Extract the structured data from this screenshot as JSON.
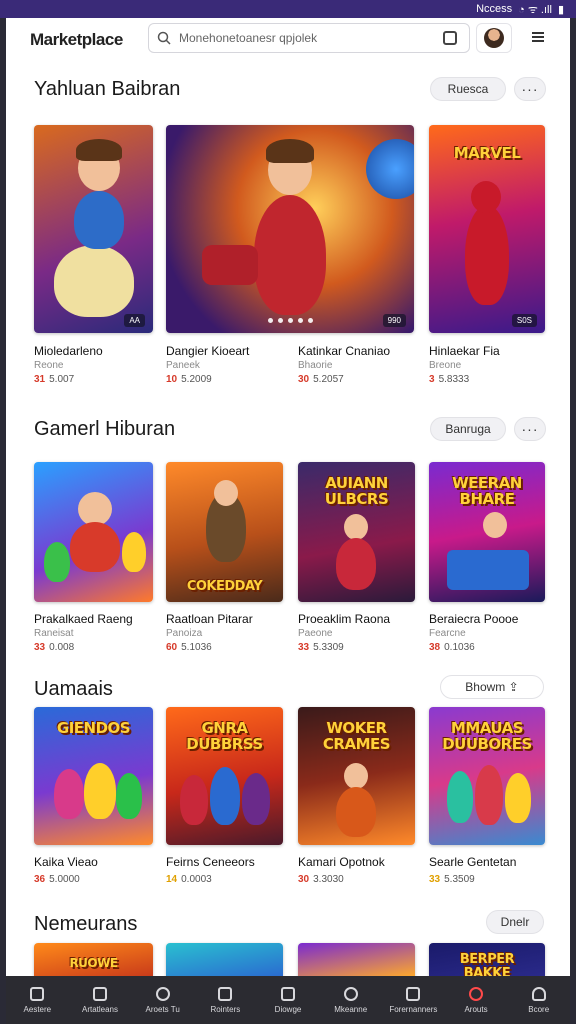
{
  "status": {
    "text": "Nccess",
    "signal": "◔ ᯤ .ıll",
    "battery": "🔋"
  },
  "header": {
    "logo": "Marketplace",
    "search": {
      "placeholder": "Monehonetoanesr qpjolek"
    },
    "icons": {
      "search": "search-icon",
      "camera": "camera-icon",
      "menu": "menu-icon"
    }
  },
  "sections": [
    {
      "title": "Yahluan Baibran",
      "action": "Ruesca",
      "more": "···",
      "items": [
        {
          "name": "Mioledarleno",
          "sub": "Reone",
          "price_red": "31",
          "price": "5.007"
        },
        {
          "name": "Dangier Kioeart",
          "sub": "Paneek",
          "price_red": "10",
          "price": "5.2009"
        },
        {
          "name": "Katinkar Cnaniao",
          "sub": "Bhaorie",
          "price_red": "30",
          "price": "5.2057"
        },
        {
          "name": "Hinlaekar Fia",
          "sub": "Breone",
          "price_red": "3",
          "price": "5.8333"
        }
      ],
      "badges": [
        "",
        "990",
        "S0S"
      ]
    },
    {
      "title": "Gamerl Hiburan",
      "action": "Banruga",
      "more": "···",
      "items": [
        {
          "name": "Prakalkaed Raeng",
          "sub": "Raneisat",
          "price_red": "33",
          "price": "0.008"
        },
        {
          "name": "Raatloan Pitarar",
          "sub": "Panoiza",
          "price_red": "60",
          "price": "5.1036"
        },
        {
          "name": "Proeaklim Raona",
          "sub": "Paeone",
          "price_red": "33",
          "price": "5.3309"
        },
        {
          "name": "Beraiecra Poooe",
          "sub": "Fearcne",
          "price_red": "38",
          "price": "0.1036"
        }
      ],
      "banners": [
        "",
        "COKEDDAY",
        "AUIANN ULBCRS",
        "WEERAN BHARE"
      ]
    },
    {
      "title": "Uamaais",
      "action": "Bhowm",
      "more": "",
      "items": [
        {
          "name": "Kaika Vieao",
          "sub": "",
          "price_red": "36",
          "price": "5.0000"
        },
        {
          "name": "Feirns Ceneeors",
          "sub": "",
          "price_red": "14",
          "price": "0.0003"
        },
        {
          "name": "Kamari Opotnok",
          "sub": "",
          "price_red": "30",
          "price": "3.3030"
        },
        {
          "name": "Searle Gentetan",
          "sub": "",
          "price_red": "33",
          "price": "5.3509"
        }
      ],
      "banners": [
        "GIENDOS",
        "GNRA DUBBRSS",
        "WOKER CRAMES",
        "MMAUAS DUUBORES"
      ]
    },
    {
      "title": "Nemeurans",
      "action": "Dnelr",
      "banners": [
        "RUOWE",
        "",
        "",
        "BERPER BAKKE"
      ]
    }
  ],
  "bottom_nav": [
    {
      "label": "Aestere",
      "icon": "home-icon"
    },
    {
      "label": "Artatleans",
      "icon": "store-icon"
    },
    {
      "label": "Aroets Tu",
      "icon": "search-icon"
    },
    {
      "label": "Rointers",
      "icon": "inbox-icon"
    },
    {
      "label": "Diowge",
      "icon": "tag-icon"
    },
    {
      "label": "Mkeanne",
      "icon": "dashboard-icon"
    },
    {
      "label": "Forernanners",
      "icon": "chart-icon"
    },
    {
      "label": "Arouts",
      "icon": "gamepad-icon"
    },
    {
      "label": "Bcore",
      "icon": "profile-icon"
    }
  ]
}
